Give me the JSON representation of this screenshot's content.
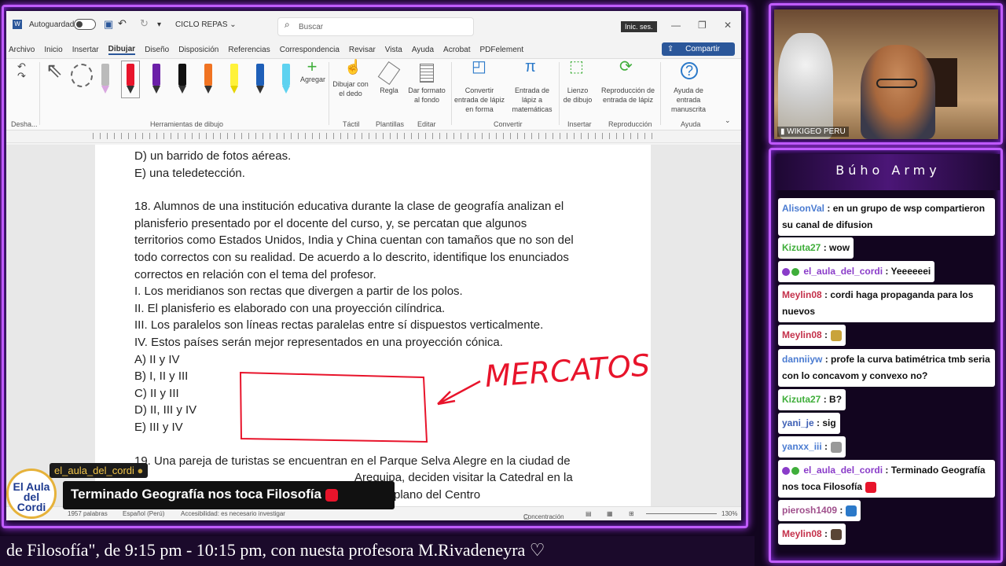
{
  "word": {
    "autosave_label": "Autoguardado",
    "doc_name": "CICLO REPAS",
    "search_placeholder": "Buscar",
    "signin_label": "Inic. ses.",
    "share_label": "Compartir",
    "menu": [
      "Archivo",
      "Inicio",
      "Insertar",
      "Dibujar",
      "Diseño",
      "Disposición",
      "Referencias",
      "Correspondencia",
      "Revisar",
      "Vista",
      "Ayuda",
      "Acrobat",
      "PDFelement"
    ],
    "ribbon": {
      "undo_group": "Desha...",
      "tools_group": "Herramientas de dibujo",
      "add_label": "Agregar",
      "draw_finger": "Dibujar con el dedo",
      "ruler": "Regla",
      "format_bg": "Dar formato al fondo",
      "convert_shape": "Convertir entrada de lápiz en forma",
      "ink_math": "Entrada de lápiz a matemáticas",
      "canvas": "Lienzo de dibujo",
      "replay": "Reproducción de entrada de lápiz",
      "ink_help": "Ayuda de entrada manuscrita",
      "groups": {
        "tactil": "Táctil",
        "plantillas": "Plantillas",
        "editar": "Editar",
        "convertir": "Convertir",
        "insertar": "Insertar",
        "reproduccion": "Reproducción",
        "ayuda": "Ayuda"
      }
    },
    "document_lines": [
      "D) un barrido de fotos aéreas.",
      "E) una teledetección.",
      "",
      "18. Alumnos de una institución educativa durante la clase de geografía analizan el",
      "planisferio presentado por el docente del curso, y, se percatan que algunos",
      "territorios como Estados Unidos, India y China cuentan con tamaños que no son del",
      "todo correctos con su realidad. De acuerdo a lo descrito, identifique los enunciados",
      "correctos en relación con el tema del profesor.",
      "I. Los meridianos son rectas que divergen a partir de los polos.",
      "II. El planisferio es elaborado con una proyección cilíndrica.",
      "III. Los paralelos son líneas rectas paralelas entre sí dispuestos verticalmente.",
      "IV. Estos países serán mejor representados en una proyección cónica.",
      "A) II y IV",
      "B) I, II y III",
      "C) II y III",
      "D) II, III y IV",
      "E) III y IV",
      "",
      "19. Una pareja de turistas se encuentran en el Parque Selva Alegre en la ciudad de",
      "Arequipa, deciden visitar la Catedral en la",
      "plano del Centro"
    ],
    "handwriting": "MERCATOS",
    "status": {
      "words": "1957 palabras",
      "lang": "Español (Perú)",
      "access": "Accesibilidad: es necesario investigar",
      "focus": "Concentración",
      "zoom": "130%"
    }
  },
  "camera": {
    "label": "WIKIGEO PERU"
  },
  "chat": {
    "title": "Búho Army",
    "messages": [
      {
        "user": "AlisonVal",
        "text": ": en un grupo de wsp compartieron su canal de difusion",
        "user_color": "#4a7bd1"
      },
      {
        "user": "Kizuta27",
        "text": ": wow",
        "user_color": "#3fae3a"
      },
      {
        "user": "el_aula_del_cordi",
        "text": ": Yeeeeeei",
        "user_color": "#8a3cc9"
      },
      {
        "user": "Meylin08",
        "text": ": cordi haga propaganda para los nuevos",
        "user_color": "#c4304a"
      },
      {
        "user": "Meylin08",
        "text": ":",
        "user_color": "#c4304a"
      },
      {
        "user": "danniiyw",
        "text": ": profe la curva batimétrica tmb seria con lo concavom y convexo no?",
        "user_color": "#4a7bd1"
      },
      {
        "user": "Kizuta27",
        "text": ": B?",
        "user_color": "#3fae3a"
      },
      {
        "user": "yani_je",
        "text": ": sig",
        "user_color": "#3d5fb5"
      },
      {
        "user": "yanxx_iii",
        "text": ":",
        "user_color": "#4a7bd1"
      },
      {
        "user": "el_aula_del_cordi",
        "text": ": Terminado Geografía nos toca Filosofía",
        "user_color": "#8a3cc9"
      },
      {
        "user": "pierosh1409",
        "text": ":",
        "user_color": "#a0508c"
      },
      {
        "user": "Meylin08",
        "text": ":",
        "user_color": "#c4304a"
      }
    ]
  },
  "overlay": {
    "notif_user": "el_aula_del_cordi",
    "notif_text": "Terminado Geografía nos toca Filosofía",
    "logo_text": "El Aula del Cordi",
    "ticker": "de Filosofía\", de 9:15 pm - 10:15 pm, con nuesta profesora M.Rivadeneyra ♡"
  }
}
